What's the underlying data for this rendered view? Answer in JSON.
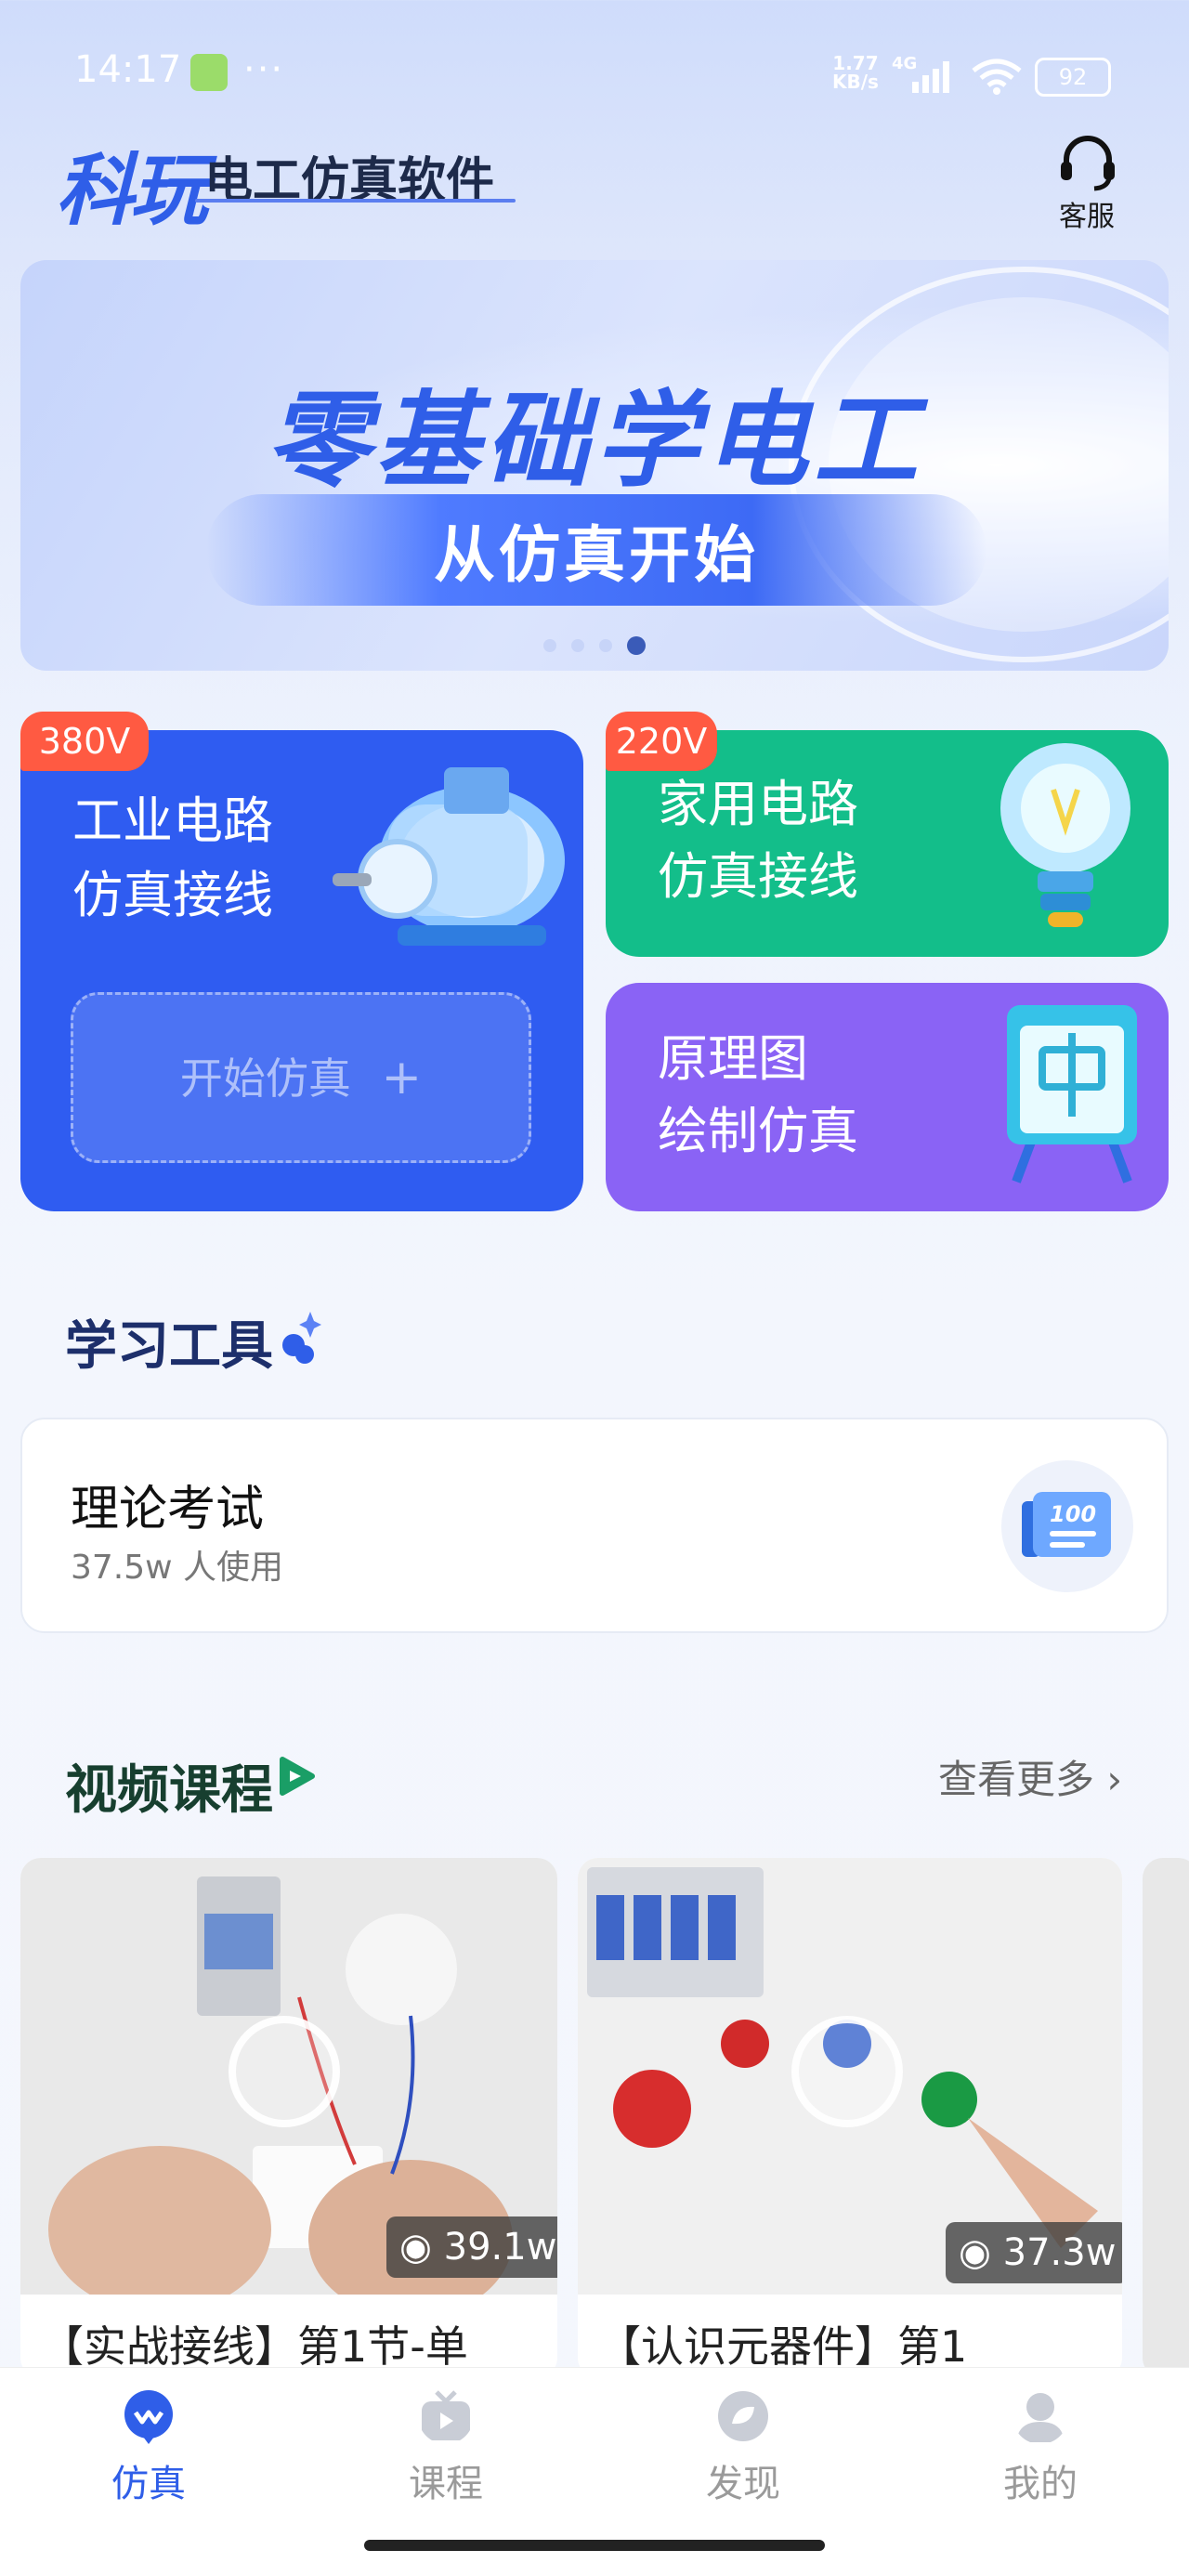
{
  "status_bar": {
    "time": "14:17",
    "more": "···",
    "net_speed_value": "1.77",
    "net_speed_unit": "KB/s",
    "network": "4G",
    "battery": "92"
  },
  "header": {
    "logo_main": "科玩",
    "logo_sub": "电工仿真软件",
    "customer_service": "客服"
  },
  "banner": {
    "title": "零基础学电工",
    "subtitle": "从仿真开始",
    "dots": 4,
    "active_dot": 4
  },
  "cards": {
    "industrial": {
      "badge": "380V",
      "line1": "工业电路",
      "line2": "仿真接线",
      "button": "开始仿真"
    },
    "home": {
      "badge": "220V",
      "line1": "家用电路",
      "line2": "仿真接线"
    },
    "schematic": {
      "line1": "原理图",
      "line2": "绘制仿真"
    }
  },
  "learning_tools": {
    "title": "学习工具",
    "items": [
      {
        "title": "理论考试",
        "users": "37.5w 人使用",
        "icon": "exam-100-icon",
        "icon_text": "100"
      }
    ]
  },
  "video_courses": {
    "title": "视频课程",
    "more": "查看更多",
    "videos": [
      {
        "views": "39.1w",
        "caption": "【实战接线】第1节-单"
      },
      {
        "views": "37.3w",
        "caption": "【认识元器件】第1"
      }
    ]
  },
  "tabbar": {
    "items": [
      {
        "label": "仿真",
        "icon": "simulation-icon",
        "active": true
      },
      {
        "label": "课程",
        "icon": "course-tv-icon",
        "active": false
      },
      {
        "label": "发现",
        "icon": "discover-icon",
        "active": false
      },
      {
        "label": "我的",
        "icon": "profile-icon",
        "active": false
      }
    ]
  },
  "colors": {
    "primary_blue": "#2f5cf1",
    "green": "#13be8a",
    "purple": "#8a63f5",
    "badge_red": "#ff5a42"
  }
}
